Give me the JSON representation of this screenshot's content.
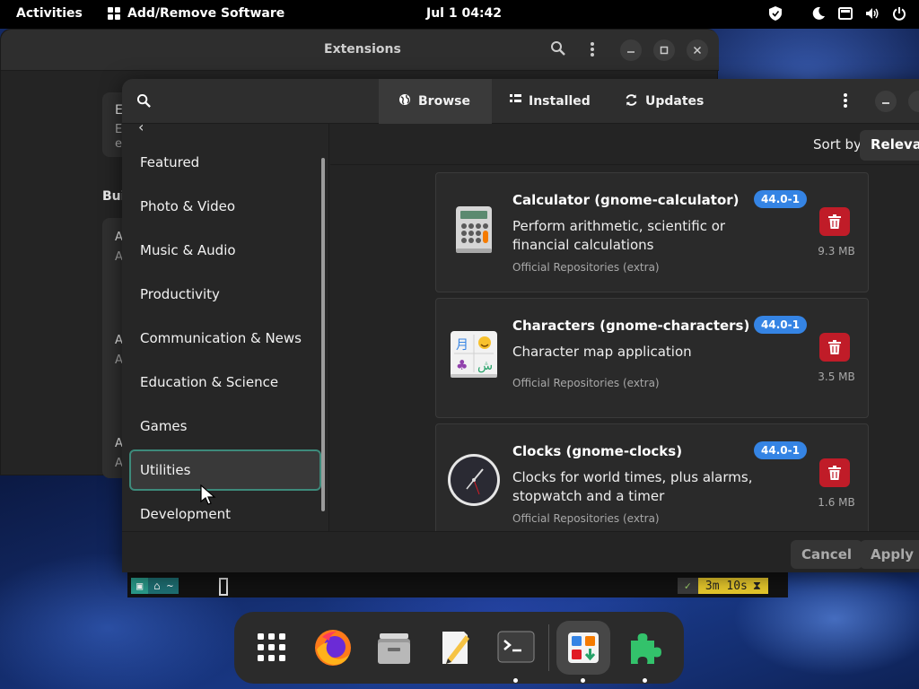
{
  "topbar": {
    "activities": "Activities",
    "app_name": "Add/Remove Software",
    "datetime": "Jul 1  04:42"
  },
  "extensions_window": {
    "title": "Extensions",
    "ghost_texts": [
      "E",
      "E",
      "e",
      "Bui",
      "A",
      "A",
      "A",
      "A",
      "A",
      "A"
    ]
  },
  "software": {
    "tabs": [
      {
        "label": "Browse",
        "icon": "globe-icon",
        "active": true
      },
      {
        "label": "Installed",
        "icon": "list-icon",
        "active": false
      },
      {
        "label": "Updates",
        "icon": "refresh-icon",
        "active": false
      }
    ],
    "categories": [
      {
        "label": "Featured"
      },
      {
        "label": "Photo & Video"
      },
      {
        "label": "Music & Audio"
      },
      {
        "label": "Productivity"
      },
      {
        "label": "Communication & News"
      },
      {
        "label": "Education & Science"
      },
      {
        "label": "Games"
      },
      {
        "label": "Utilities"
      },
      {
        "label": "Development"
      }
    ],
    "selected_category": "Utilities",
    "sort_label": "Sort by",
    "sort_value": "Relevance",
    "apps": [
      {
        "name": "Calculator (gnome-calculator)",
        "description": "Perform arithmetic, scientific or financial calculations",
        "repository": "Official Repositories (extra)",
        "version": "44.0-1",
        "size": "9.3 MB",
        "icon": "calculator-icon"
      },
      {
        "name": "Characters (gnome-characters)",
        "description": "Character map application",
        "repository": "Official Repositories (extra)",
        "version": "44.0-1",
        "size": "3.5 MB",
        "icon": "characters-icon"
      },
      {
        "name": "Clocks (gnome-clocks)",
        "description": "Clocks for world times, plus alarms, stopwatch and a timer",
        "repository": "Official Repositories (extra)",
        "version": "44.0-1",
        "size": "1.6 MB",
        "icon": "clock-icon"
      }
    ],
    "footer": {
      "cancel": "Cancel",
      "apply": "Apply"
    }
  },
  "terminal": {
    "status_time": "3m 10s",
    "status_ok": "✓",
    "home": "~"
  },
  "dock": [
    {
      "name": "app-grid",
      "icon": "app-grid-icon"
    },
    {
      "name": "firefox",
      "icon": "firefox-icon"
    },
    {
      "name": "files",
      "icon": "files-icon"
    },
    {
      "name": "text-editor",
      "icon": "text-editor-icon"
    },
    {
      "name": "terminal",
      "icon": "terminal-icon"
    },
    {
      "name": "software",
      "icon": "software-icon"
    },
    {
      "name": "extensions",
      "icon": "extensions-icon"
    }
  ],
  "colors": {
    "accent": "#3584e4",
    "destructive": "#c01c28",
    "selection_border": "#3d8a7b"
  }
}
